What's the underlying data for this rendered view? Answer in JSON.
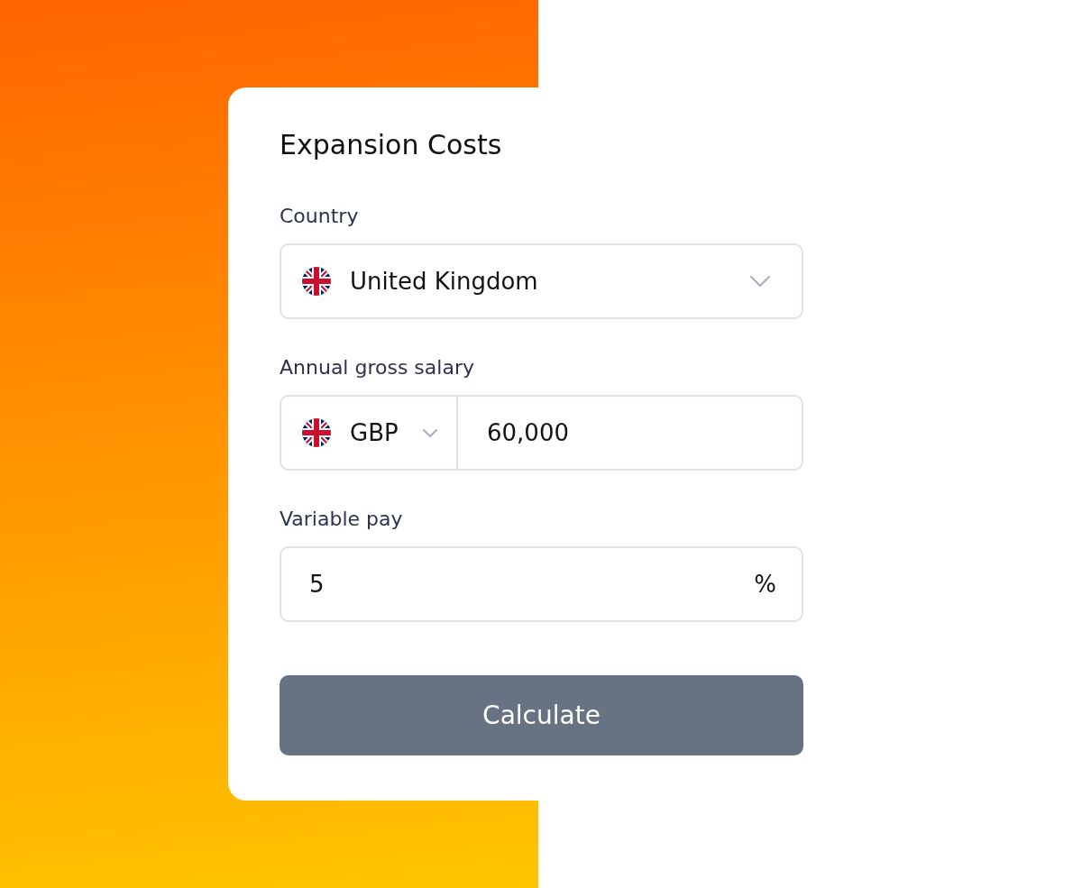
{
  "card": {
    "title": "Expansion Costs",
    "fields": [
      {
        "kind": "select",
        "label": "Country",
        "value": "United Kingdom"
      },
      {
        "kind": "currency_amount",
        "label": "Annual gross salary",
        "currency": "GBP",
        "value": "60,000"
      },
      {
        "kind": "suffix",
        "label": "Variable pay",
        "value": "5",
        "suffix": "%"
      }
    ],
    "button": "Calculate"
  }
}
